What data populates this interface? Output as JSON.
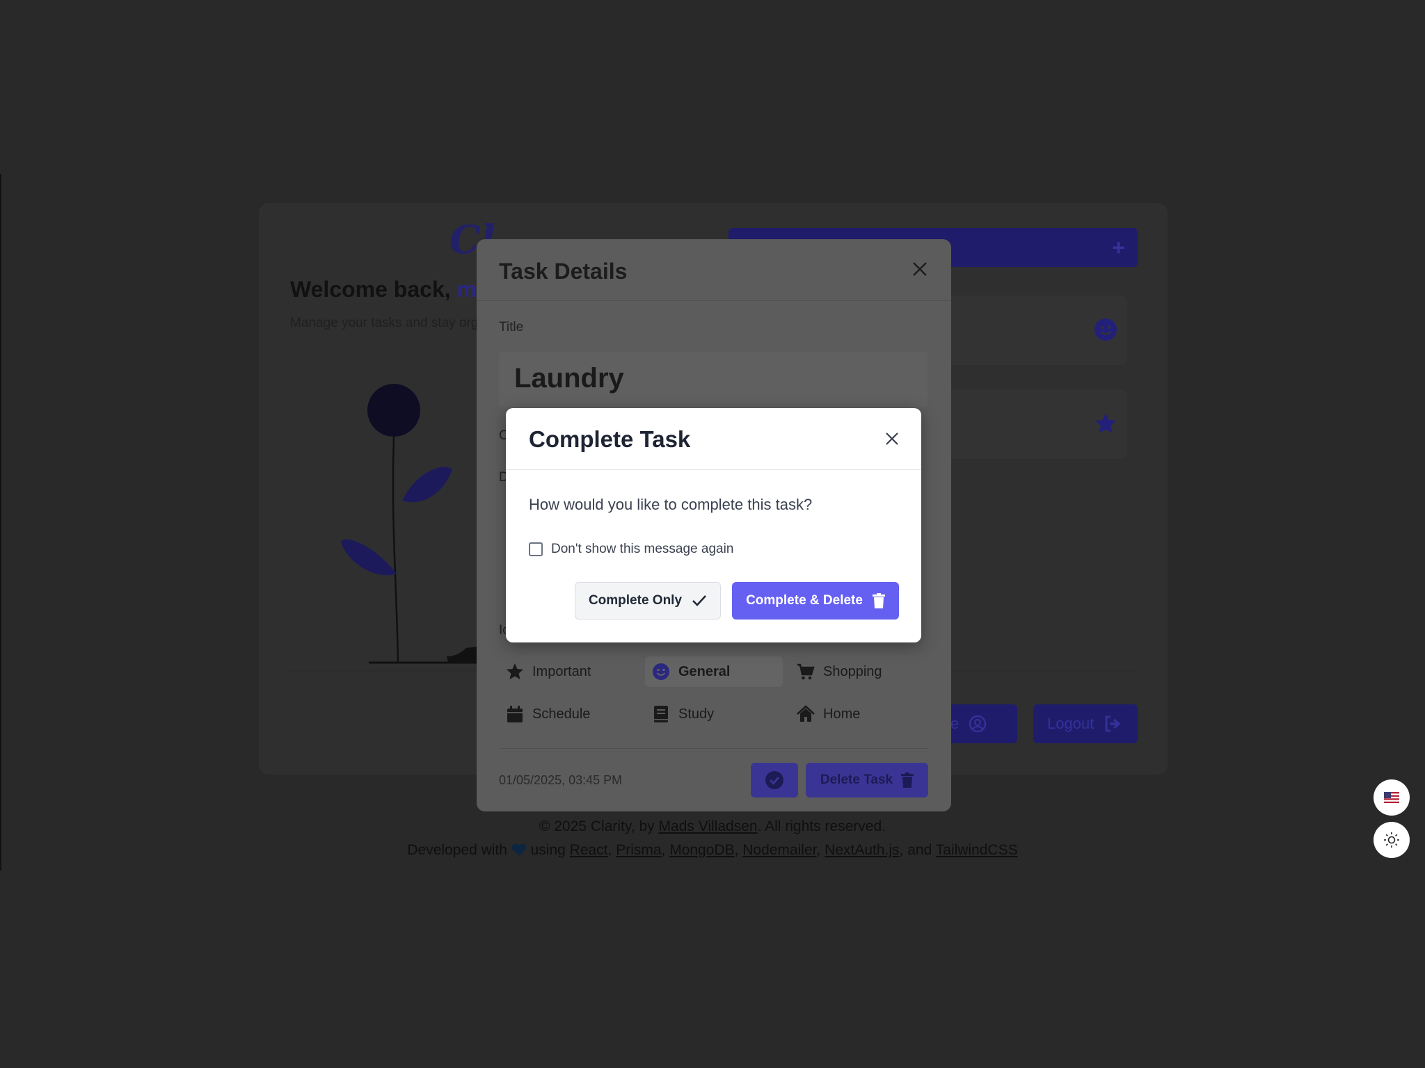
{
  "background_app": {
    "logo": "Cl",
    "welcome_prefix": "Welcome back, ",
    "welcome_user": "my",
    "subtitle": "Manage your tasks and stay orga",
    "add_task_icon": "plus-icon",
    "card_icons": [
      "smile-icon",
      "star-icon"
    ],
    "profile_label": "file",
    "logout_label": "Logout"
  },
  "task_details": {
    "header": "Task Details",
    "title_label": "Title",
    "title_value": "Laundry",
    "partial_label_1": "C",
    "partial_label_2": "D",
    "partial_label_3": "Ic",
    "categories": [
      {
        "label": "Important",
        "icon": "star-icon",
        "selected": false
      },
      {
        "label": "General",
        "icon": "smile-icon",
        "selected": true
      },
      {
        "label": "Shopping",
        "icon": "cart-icon",
        "selected": false
      },
      {
        "label": "Schedule",
        "icon": "calendar-icon",
        "selected": false
      },
      {
        "label": "Study",
        "icon": "book-icon",
        "selected": false
      },
      {
        "label": "Home",
        "icon": "house-icon",
        "selected": false
      }
    ],
    "timestamp": "01/05/2025, 03:45 PM",
    "delete_label": "Delete Task"
  },
  "dialog": {
    "title": "Complete Task",
    "question": "How would you like to complete this task?",
    "checkbox_label": "Don't show this message again",
    "checkbox_checked": false,
    "complete_only_label": "Complete Only",
    "complete_delete_label": "Complete & Delete"
  },
  "footer": {
    "line1_prefix": "© 2025 Clarity, by ",
    "author": "Mads Villadsen",
    "line1_suffix": ". All rights reserved.",
    "line2_prefix": "Developed with ",
    "line2_using": " using ",
    "tech": [
      "React",
      "Prisma",
      "MongoDB",
      "Nodemailer",
      "NextAuth.js"
    ],
    "and": ", and ",
    "last_tech": "TailwindCSS"
  },
  "colors": {
    "accent": "#6660f2",
    "overlay_background": "#292929"
  }
}
